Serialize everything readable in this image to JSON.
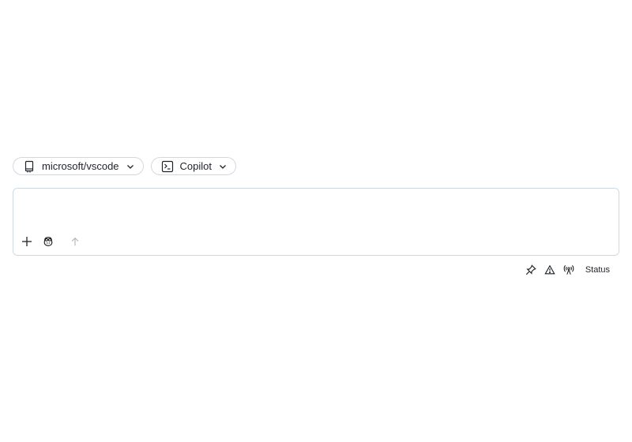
{
  "repo_selector": {
    "label": "microsoft/vscode",
    "icon": "repo-icon"
  },
  "agent_selector": {
    "label": "Copilot",
    "icon": "terminal-icon"
  },
  "composer": {
    "placeholder": "",
    "toolbar": {
      "add_icon": "plus-icon",
      "agent_icon": "copilot-icon",
      "send_icon": "arrow-up-icon"
    }
  },
  "status_bar": {
    "icons": [
      "pin-icon",
      "warning-icon",
      "broadcast-icon"
    ],
    "status_label": "Status"
  },
  "colors": {
    "border": "#d1d9e0",
    "text": "#1f2328",
    "muted_icon": "#b0b7be"
  }
}
